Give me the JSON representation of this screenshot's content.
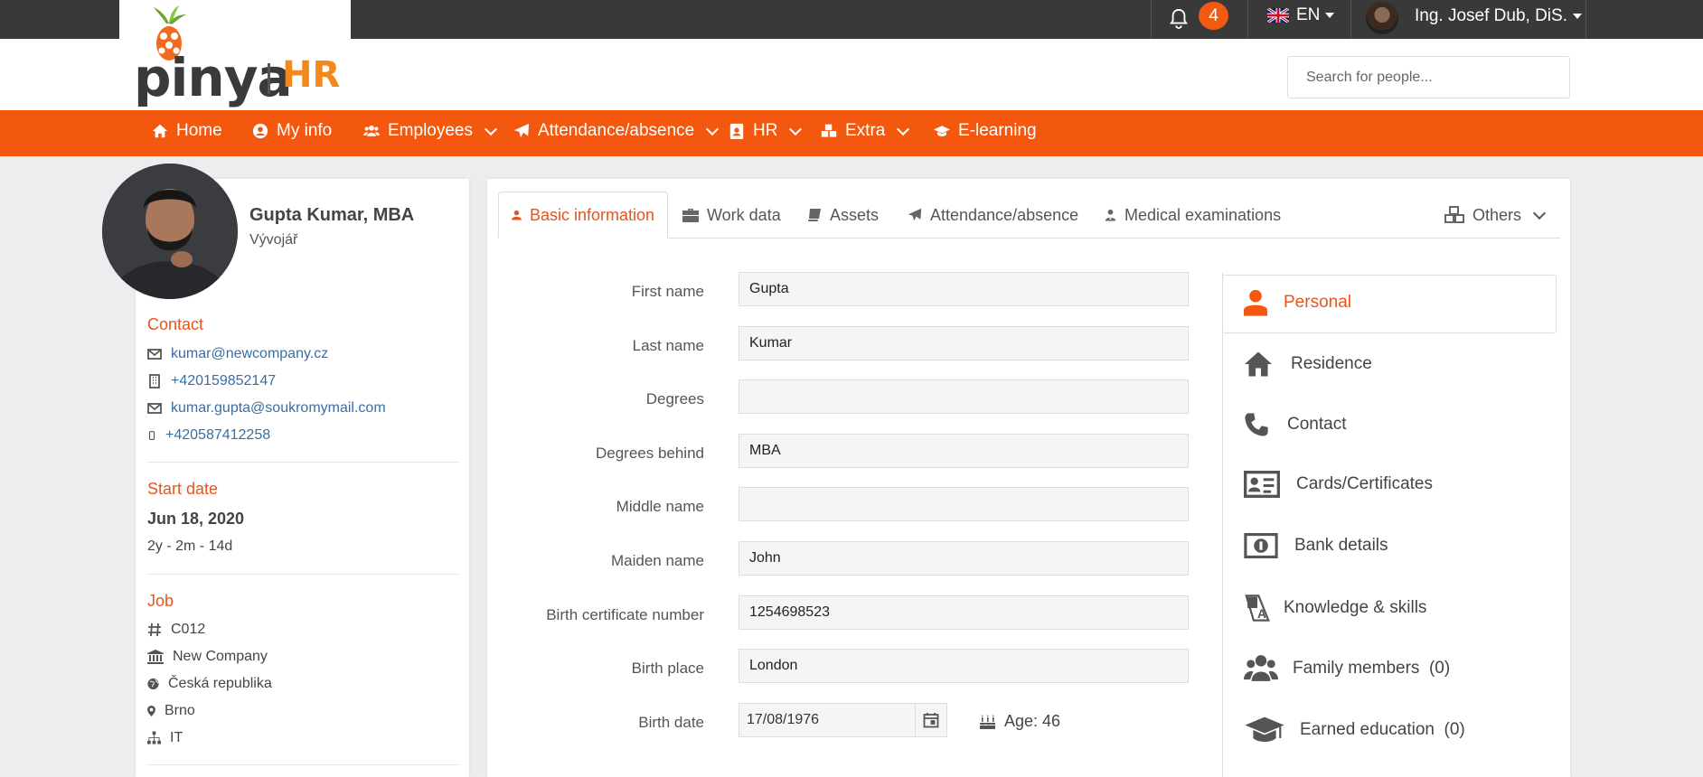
{
  "app": {
    "logo_text": "pinya",
    "logo_suffix": "HR"
  },
  "topbar": {
    "notification_count": "4",
    "language": "EN",
    "user_name": "Ing. Josef Dub, DiS."
  },
  "search": {
    "placeholder": "Search for people..."
  },
  "nav": {
    "items": [
      {
        "label": "Home",
        "icon": "home-icon"
      },
      {
        "label": "My info",
        "icon": "user-circle-icon"
      },
      {
        "label": "Employees",
        "icon": "users-icon"
      },
      {
        "label": "Attendance/absence",
        "icon": "plane-icon"
      },
      {
        "label": "HR",
        "icon": "id-badge-icon"
      },
      {
        "label": "Extra",
        "icon": "cubes-icon"
      },
      {
        "label": "E-learning",
        "icon": "graduation-cap-icon"
      }
    ]
  },
  "profile": {
    "name": "Gupta Kumar, MBA",
    "role": "Vývojář",
    "contact_title": "Contact",
    "contacts": [
      {
        "icon": "envelope-icon",
        "value": "kumar@newcompany.cz"
      },
      {
        "icon": "building-phone-icon",
        "value": "+420159852147"
      },
      {
        "icon": "envelope-icon",
        "value": "kumar.gupta@soukromymail.com"
      },
      {
        "icon": "mobile-icon",
        "value": "+420587412258"
      }
    ],
    "start_title": "Start date",
    "start_date": "Jun 18, 2020",
    "tenure": "2y - 2m - 14d",
    "job_title": "Job",
    "job": [
      {
        "icon": "hashtag-icon",
        "value": "C012"
      },
      {
        "icon": "bank-icon",
        "value": "New Company"
      },
      {
        "icon": "globe-icon",
        "value": "Česká republika"
      },
      {
        "icon": "map-marker-icon",
        "value": "Brno"
      },
      {
        "icon": "sitemap-icon",
        "value": "IT"
      }
    ]
  },
  "tabs": [
    {
      "label": "Basic information",
      "icon": "user-icon",
      "active": true
    },
    {
      "label": "Work data",
      "icon": "briefcase-icon"
    },
    {
      "label": "Assets",
      "icon": "book-icon"
    },
    {
      "label": "Attendance/absence",
      "icon": "plane-icon"
    },
    {
      "label": "Medical examinations",
      "icon": "user-md-icon"
    },
    {
      "label": "Others",
      "icon": "cubes-icon"
    }
  ],
  "form": {
    "fields": [
      {
        "label": "First name",
        "value": "Gupta"
      },
      {
        "label": "Last name",
        "value": "Kumar"
      },
      {
        "label": "Degrees",
        "value": ""
      },
      {
        "label": "Degrees behind",
        "value": "MBA"
      },
      {
        "label": "Middle name",
        "value": ""
      },
      {
        "label": "Maiden name",
        "value": "John"
      },
      {
        "label": "Birth certificate number",
        "value": "1254698523"
      },
      {
        "label": "Birth place",
        "value": "London"
      }
    ],
    "birth_date_label": "Birth date",
    "birth_date": "17/08/1976",
    "age": "Age: 46"
  },
  "side_menu": {
    "items": [
      {
        "label": "Personal",
        "icon": "user-icon",
        "active": true
      },
      {
        "label": "Residence",
        "icon": "home-icon"
      },
      {
        "label": "Contact",
        "icon": "phone-icon"
      },
      {
        "label": "Cards/Certificates",
        "icon": "id-card-icon"
      },
      {
        "label": "Bank details",
        "icon": "money-bill-icon"
      },
      {
        "label": "Knowledge & skills",
        "icon": "language-icon"
      },
      {
        "label": "Family members  (0)",
        "icon": "users-icon"
      },
      {
        "label": "Earned education  (0)",
        "icon": "graduation-cap-icon"
      }
    ]
  },
  "colors": {
    "accent": "#f4580f",
    "accent_text": "#e8541b",
    "topbar": "#393939",
    "link": "#3a6ea5"
  }
}
